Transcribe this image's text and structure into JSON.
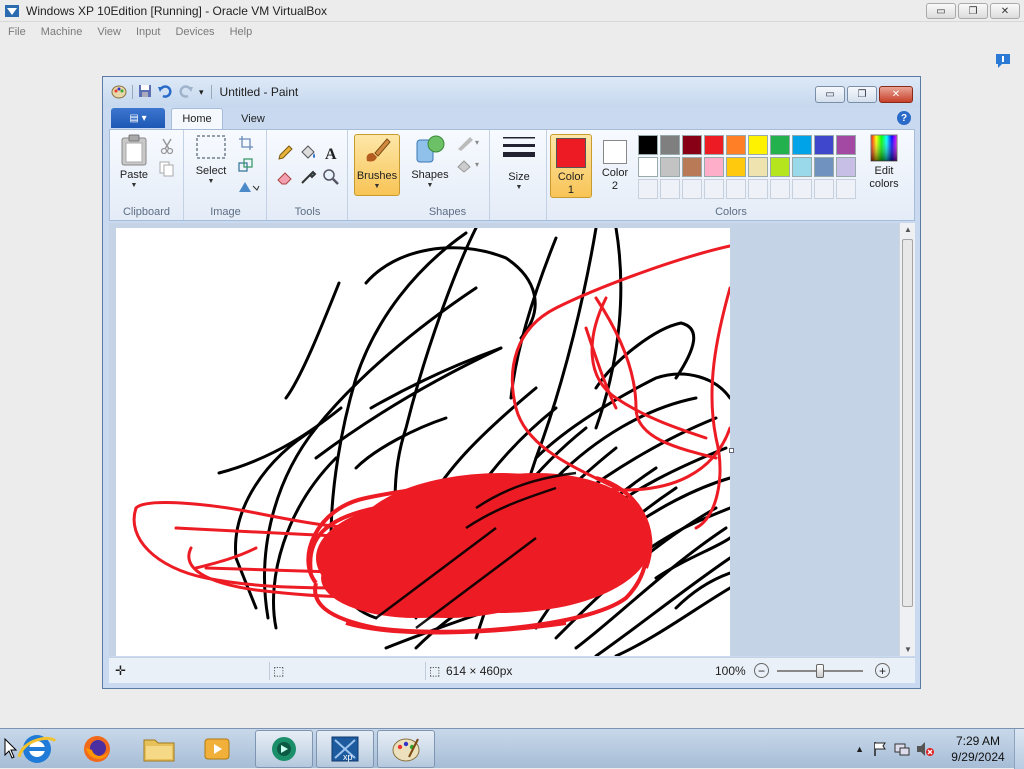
{
  "vbox": {
    "title": "Windows XP 10Edition [Running] - Oracle VM VirtualBox",
    "menu": [
      "File",
      "Machine",
      "View",
      "Input",
      "Devices",
      "Help"
    ],
    "controls": {
      "minimize": "▭",
      "restore": "❐",
      "close": "✕"
    }
  },
  "paint": {
    "title": "Untitled - Paint",
    "tabs": {
      "home": "Home",
      "view": "View"
    },
    "help": "?",
    "groups": {
      "clipboard": {
        "label": "Clipboard",
        "paste": "Paste"
      },
      "image": {
        "label": "Image",
        "select": "Select"
      },
      "tools": {
        "label": "Tools"
      },
      "brushes": {
        "label": "Brushes"
      },
      "shapes": {
        "label": "Shapes",
        "shapes_btn": "Shapes"
      },
      "size": {
        "label": "Size"
      },
      "colors": {
        "label": "Colors",
        "color1_line1": "Color",
        "color1_line2": "1",
        "color2_line1": "Color",
        "color2_line2": "2",
        "edit_line1": "Edit",
        "edit_line2": "colors",
        "color1_value": "#ed1c24",
        "color2_value": "#ffffff",
        "palette_row1": [
          "#000000",
          "#7f7f7f",
          "#880015",
          "#ed1c24",
          "#ff7f27",
          "#fff200",
          "#22b14c",
          "#00a2e8",
          "#3f48cc",
          "#a349a4"
        ],
        "palette_row2": [
          "#ffffff",
          "#c3c3c3",
          "#b97a57",
          "#ffaec9",
          "#ffc90e",
          "#efe4b0",
          "#b5e61d",
          "#99d9ea",
          "#7092be",
          "#c8bfe7"
        ]
      }
    },
    "status": {
      "dimensions": "614 × 460px",
      "zoom": "100%"
    }
  },
  "taskbar": {
    "time": "7:29 AM",
    "date": "9/29/2024",
    "icons": [
      "start-orb",
      "internet-explorer",
      "firefox",
      "file-explorer",
      "media-player",
      "windows-media-center",
      "virtualbox-xp",
      "paint"
    ]
  }
}
